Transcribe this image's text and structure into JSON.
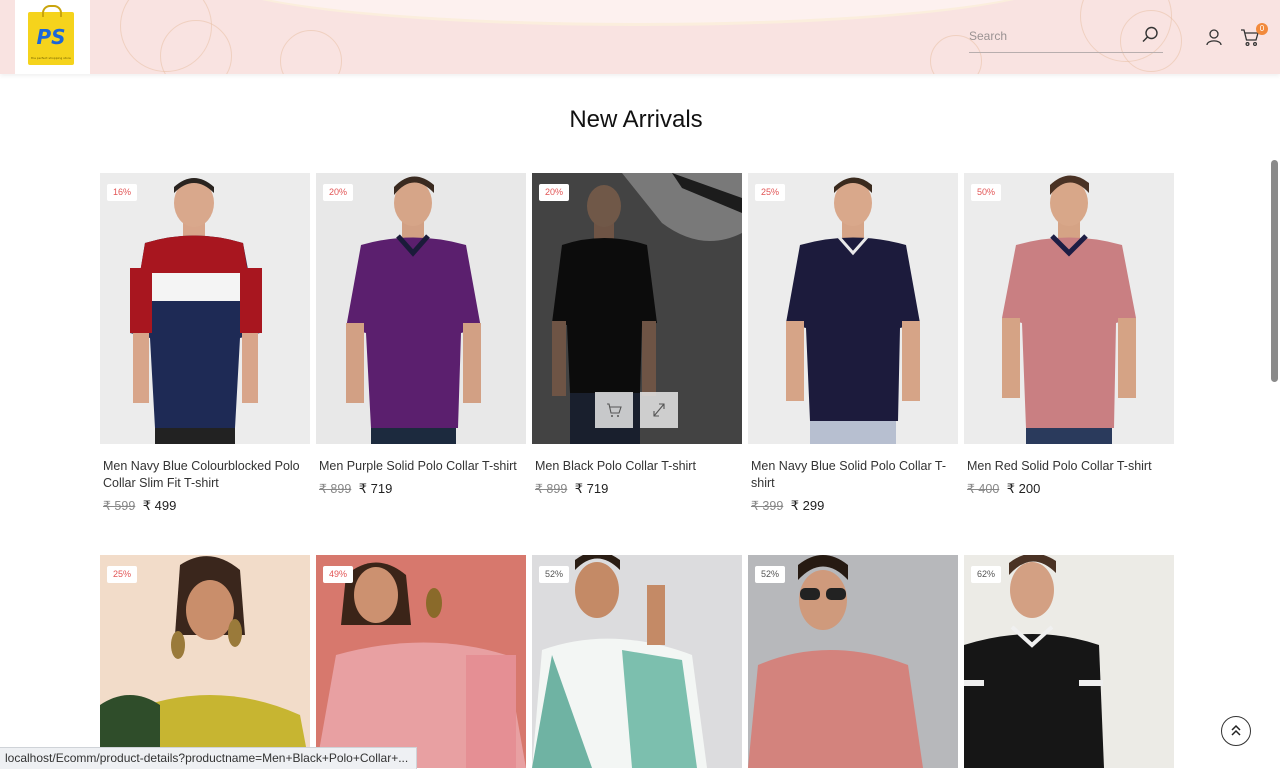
{
  "header": {
    "logo_text": "PS",
    "logo_tagline": "the perfect shopping store for all",
    "search_placeholder": "Search",
    "cart_count": "0"
  },
  "section_title": "New Arrivals",
  "products_row1": [
    {
      "discount": "16%",
      "name": "Men Navy Blue Colourblocked Polo Collar Slim Fit T-shirt",
      "old_price": "₹ 599",
      "new_price": "₹ 499"
    },
    {
      "discount": "20%",
      "name": "Men Purple Solid Polo Collar T-shirt",
      "old_price": "₹ 899",
      "new_price": "₹ 719"
    },
    {
      "discount": "20%",
      "name": "Men Black Polo Collar T-shirt",
      "old_price": "₹ 899",
      "new_price": "₹ 719"
    },
    {
      "discount": "25%",
      "name": "Men Navy Blue Solid Polo Collar T-shirt",
      "old_price": "₹ 399",
      "new_price": "₹ 299"
    },
    {
      "discount": "50%",
      "name": "Men Red Solid Polo Collar T-shirt",
      "old_price": "₹ 400",
      "new_price": "₹ 200"
    }
  ],
  "products_row2": [
    {
      "discount": "25%"
    },
    {
      "discount": "49%"
    },
    {
      "discount": "52%"
    },
    {
      "discount": "52%"
    },
    {
      "discount": "62%"
    }
  ],
  "status_url": "localhost/Ecomm/product-details?productname=Men+Black+Polo+Collar+...",
  "icons": {
    "search": "search-icon",
    "user": "user-icon",
    "cart": "cart-icon",
    "add_to_cart": "cart-icon",
    "quick_view": "expand-icon",
    "scroll_top": "double-chevron-up-icon"
  },
  "colors": {
    "header_bg": "#f9e3e1",
    "badge_text": "#e25555",
    "cart_badge": "#f28a3c",
    "logo_bag": "#f5d31c"
  }
}
